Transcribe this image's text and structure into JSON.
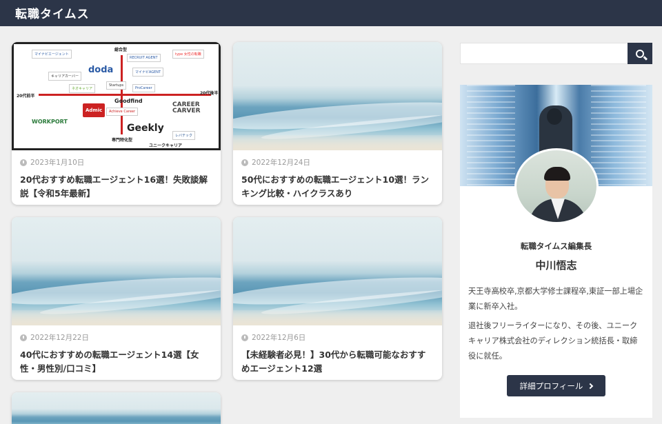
{
  "header": {
    "site_title": "転職タイムス"
  },
  "articles": [
    {
      "date": "2023年1月10日",
      "title": "20代おすすめ転職エージェント16選！失敗談解説【令和5年最新】",
      "thumbnail": "agent-map-infographic"
    },
    {
      "date": "2022年12月24日",
      "title": "50代におすすめの転職エージェント10選！ランキング比較・ハイクラスあり",
      "thumbnail": "ocean"
    },
    {
      "date": "2022年12月22日",
      "title": "40代におすすめの転職エージェント14選【女性・男性別/口コミ】",
      "thumbnail": "ocean"
    },
    {
      "date": "2022年12月6日",
      "title": "【未経験者必見！】30代から転職可能なおすすめエージェント12選",
      "thumbnail": "ocean"
    }
  ],
  "infographic": {
    "top": "総合型",
    "bottom": "専門特化型",
    "left": "20代前半",
    "right": "20代後半",
    "logos": [
      "マイナビエージェント",
      "RECRUIT AGENT",
      "type 女性の転職",
      "doda",
      "マイナビAGENT",
      "キャリアカーバー",
      "Startups",
      "ProCareer",
      "ネオキャリア",
      "Goodfind",
      "CAREER CARVER",
      "Admic",
      "Achieve Career",
      "WORKPORT",
      "Geekly",
      "レバテック",
      "ユニークキャリア"
    ]
  },
  "sidebar": {
    "search_placeholder": "",
    "profile": {
      "role": "転職タイムス編集長",
      "name": "中川悟志",
      "bio1": "天王寺高校卒,京都大学修士課程卒,東証一部上場企業に新卒入社。",
      "bio2": "退社後フリーライターになり、その後、ユニークキャリア株式会社のディレクション統括長・取締役に就任。",
      "button_label": "詳細プロフィール"
    }
  },
  "colors": {
    "header": "#2c3548",
    "accent": "#c22222"
  }
}
